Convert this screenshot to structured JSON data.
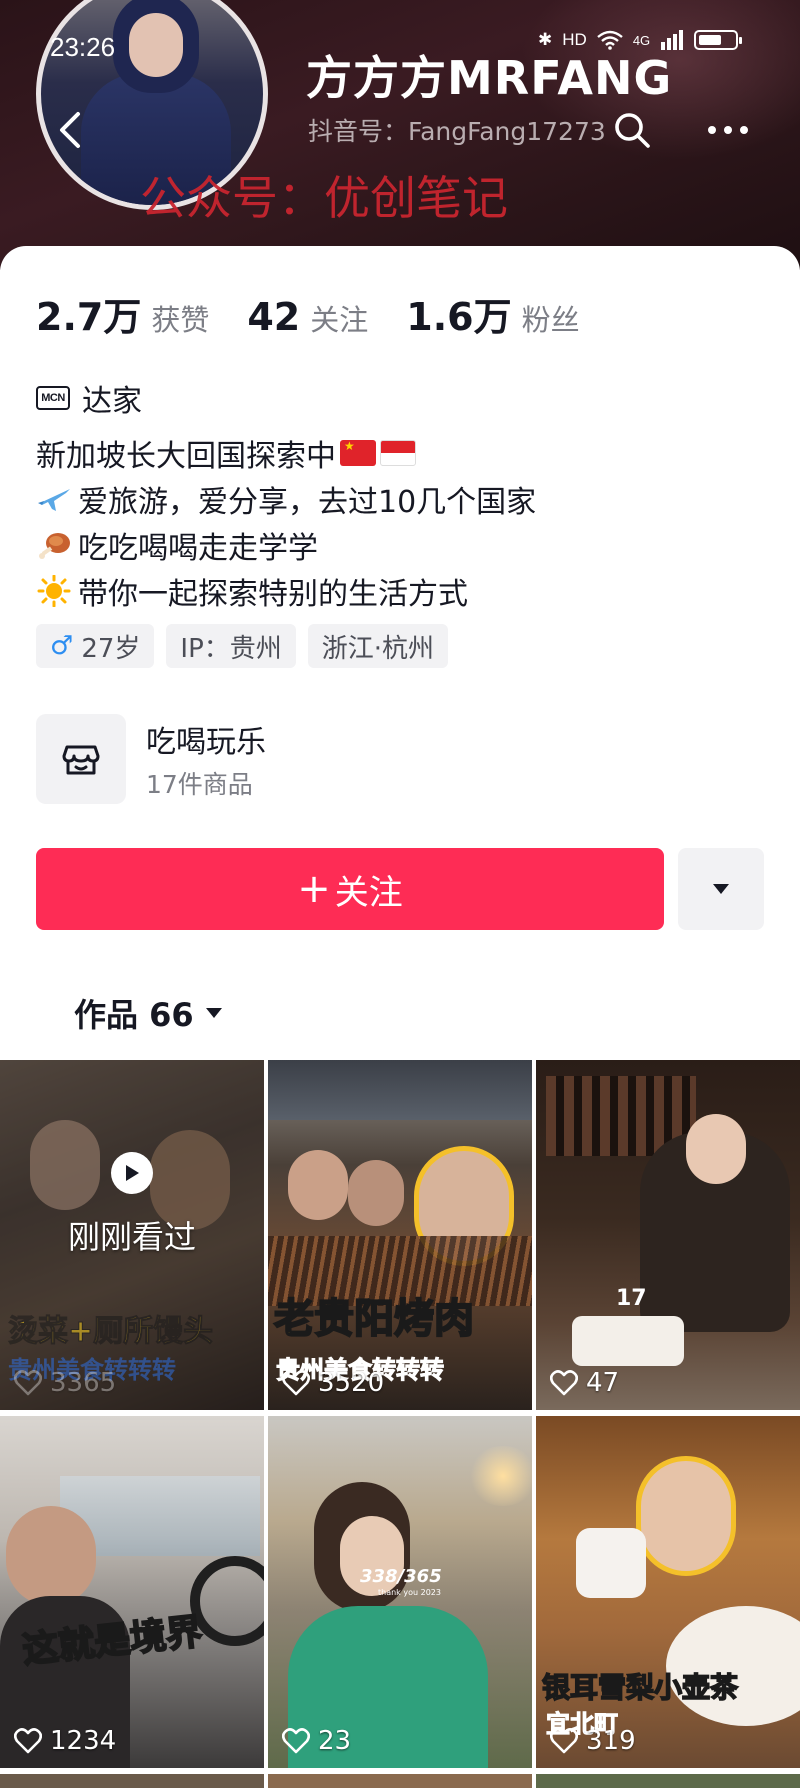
{
  "status_bar": {
    "time": "23:26",
    "network": "HD",
    "cell": "4G"
  },
  "profile": {
    "nickname": "方方方MRFANG",
    "douyin_id": "抖音号：FangFang17273",
    "watermark": "公众号：优创笔记"
  },
  "stats": [
    {
      "value": "2.7万",
      "label": "获赞"
    },
    {
      "value": "42",
      "label": "关注"
    },
    {
      "value": "1.6万",
      "label": "粉丝"
    }
  ],
  "mcn": {
    "badge": "MCN",
    "label": "达家"
  },
  "bio": {
    "line1": "新加坡长大回国探索中",
    "line2": "爱旅游，爱分享，去过10几个国家",
    "line3": "吃吃喝喝走走学学",
    "line4": "带你一起探索特别的生活方式"
  },
  "tags": {
    "age": "27岁",
    "ip": "IP：贵州",
    "location": "浙江·杭州"
  },
  "shop": {
    "title": "吃喝玩乐",
    "count": "17件商品"
  },
  "actions": {
    "follow_label": "关注"
  },
  "works_tab": {
    "label": "作品 66"
  },
  "videos": [
    {
      "caption1": "烫菜+厕所馒头",
      "caption2": "贵州美食转转转",
      "likes": "3365",
      "watched_label": "刚刚看过"
    },
    {
      "caption1": "老贵阳烤肉",
      "caption2": "贵州美食转转转",
      "likes": "3520"
    },
    {
      "caption1": "",
      "likes": "47",
      "cake_text": "17"
    },
    {
      "caption1": "这就是境界",
      "likes": "1234"
    },
    {
      "caption1": "338/365",
      "caption2": "thank you 2023",
      "likes": "23"
    },
    {
      "caption1": "银耳雪梨小壶茶",
      "caption2": "宜北町",
      "likes": "319"
    }
  ],
  "colors": {
    "accent": "#fe2c55",
    "header_bg": "#2a1318",
    "watermark": "#c8252f",
    "caption_yellow": "#ffd21f",
    "caption_blue": "#2f6fe0",
    "male": "#2d8ef1"
  }
}
